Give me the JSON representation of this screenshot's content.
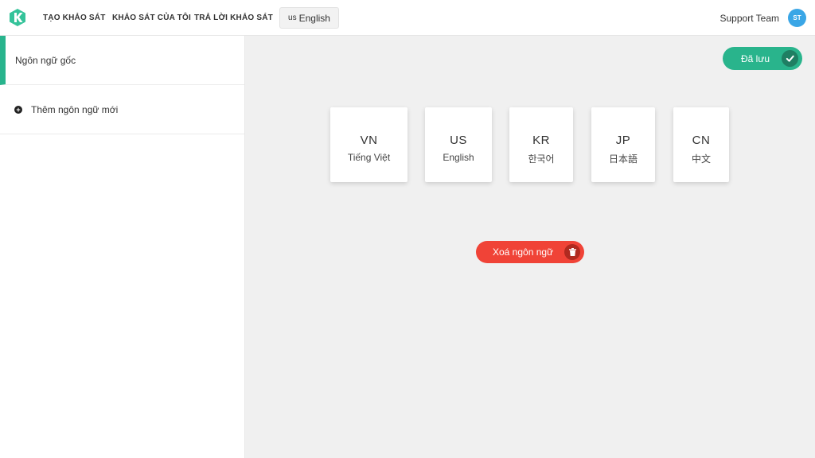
{
  "header": {
    "logo_icon": "k-logo-icon",
    "nav": [
      {
        "label": "TẠO KHẢO SÁT"
      },
      {
        "label": "KHẢO SÁT CỦA TÔI"
      },
      {
        "label": "TRẢ LỜI KHẢO SÁT"
      }
    ],
    "language_selector": {
      "code": "us",
      "label": "English"
    },
    "user": {
      "name": "Support Team",
      "initials": "ST"
    }
  },
  "sidebar": {
    "items": [
      {
        "label": "Ngôn ngữ gốc"
      },
      {
        "label": "Thêm ngôn ngữ mới",
        "icon": "plus-circle-icon"
      }
    ]
  },
  "main": {
    "saved_button": {
      "label": "Đã lưu",
      "icon": "check-icon"
    },
    "languages": [
      {
        "code": "VN",
        "name": "Tiếng Việt"
      },
      {
        "code": "US",
        "name": "English"
      },
      {
        "code": "KR",
        "name": "한국어"
      },
      {
        "code": "JP",
        "name": "日本語"
      },
      {
        "code": "CN",
        "name": "中文"
      }
    ],
    "delete_button": {
      "label": "Xoá ngôn ngữ",
      "icon": "trash-icon"
    }
  },
  "colors": {
    "accent": "#28b48d",
    "danger": "#f04337",
    "avatar": "#3aa6e6"
  }
}
